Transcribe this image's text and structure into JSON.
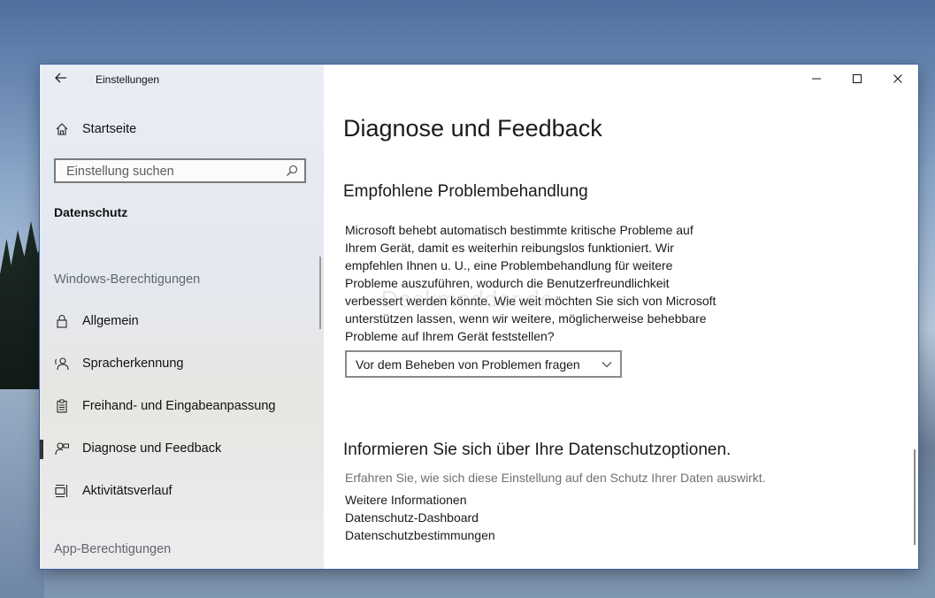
{
  "window": {
    "title": "Einstellungen",
    "back_icon": "back-arrow-icon",
    "controls": [
      "minimize-icon",
      "maximize-icon",
      "close-icon"
    ]
  },
  "sidebar": {
    "home": {
      "label": "Startseite",
      "icon": "home-icon"
    },
    "search": {
      "placeholder": "Einstellung suchen",
      "icon": "search-icon"
    },
    "section": "Datenschutz",
    "group_windows": "Windows-Berechtigungen",
    "items": [
      {
        "label": "Allgemein",
        "icon": "lock-icon"
      },
      {
        "label": "Spracherkennung",
        "icon": "speech-icon"
      },
      {
        "label": "Freihand- und Eingabeanpassung",
        "icon": "clipboard-icon"
      },
      {
        "label": "Diagnose und Feedback",
        "icon": "feedback-icon",
        "active": true
      },
      {
        "label": "Aktivitätsverlauf",
        "icon": "timeline-icon"
      }
    ],
    "group_apps": "App-Berechtigungen"
  },
  "main": {
    "title": "Diagnose und Feedback",
    "troubleshoot": {
      "heading": "Empfohlene Problembehandlung",
      "description_lines": [
        "Microsoft behebt automatisch bestimmte kritische Probleme auf",
        "Ihrem Gerät, damit es weiterhin reibungslos funktioniert. Wir",
        "empfehlen Ihnen u. U., eine Problembehandlung für weitere",
        "Probleme auszuführen, wodurch die Benutzerfreundlichkeit",
        "verbessert werden könnte. Wie weit möchten Sie sich von Microsoft",
        "unterstützen lassen, wenn wir weitere, möglicherweise behebbare",
        "Probleme auf Ihrem Gerät feststellen?"
      ],
      "dropdown_value": "Vor dem Beheben von Problemen fragen"
    },
    "privacy": {
      "heading": "Informieren Sie sich über Ihre Datenschutzoptionen.",
      "subtext": "Erfahren Sie, wie sich diese Einstellung auf den Schutz Ihrer Daten auswirkt.",
      "links": [
        "Weitere Informationen",
        "Datenschutz-Dashboard",
        "Datenschutzbestimmungen"
      ]
    },
    "watermark": "Deskmodder.de"
  },
  "colors": {
    "accent": "#0063b1",
    "sidebar_bg": "#e5e9f0",
    "content_bg": "#ffffff",
    "secondary_text": "#707070"
  }
}
